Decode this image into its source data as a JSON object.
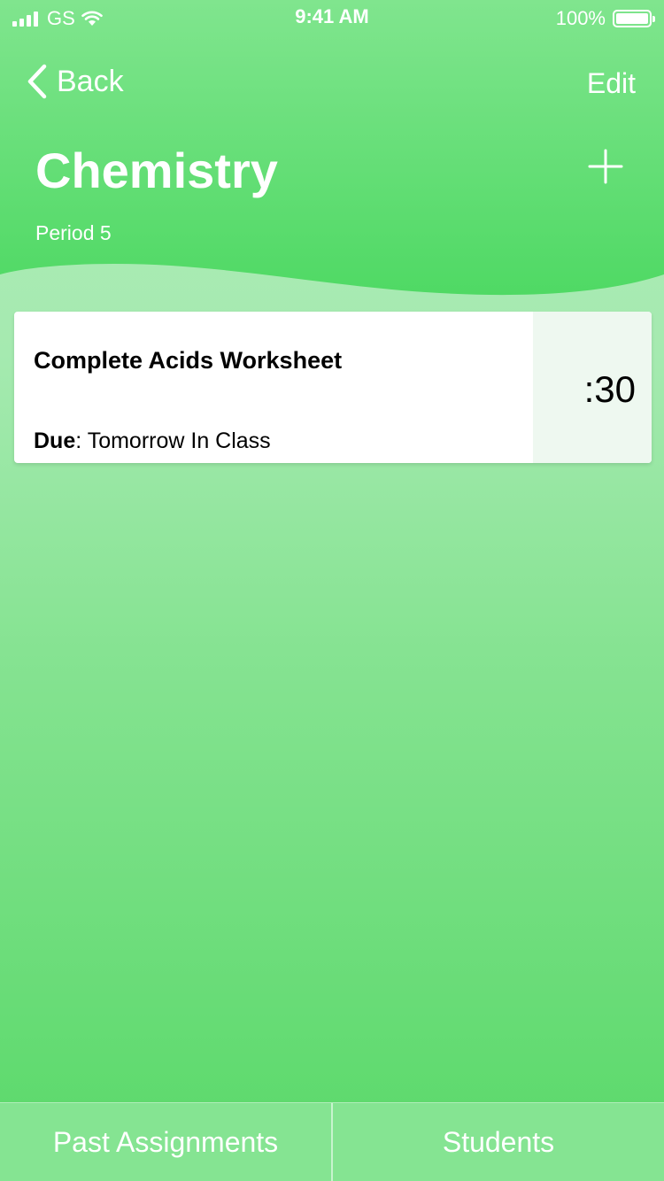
{
  "status_bar": {
    "carrier": "GS",
    "time": "9:41 AM",
    "battery": "100%"
  },
  "nav": {
    "back_label": "Back",
    "edit_label": "Edit"
  },
  "header": {
    "title": "Chemistry",
    "subtitle": "Period 5",
    "add_icon": "plus-icon"
  },
  "assignments": [
    {
      "title": "Complete Acids Worksheet",
      "due_label": "Due",
      "due_value": "Tomorrow In Class",
      "time": ":30"
    }
  ],
  "tabs": [
    {
      "label": "Past Assignments"
    },
    {
      "label": "Students"
    }
  ],
  "colors": {
    "header_green": "#4cd964",
    "background_top": "#b2edb9",
    "background_bottom": "#58d968",
    "tabbar": "#85e492",
    "card_time_bg": "#eef8f0"
  }
}
